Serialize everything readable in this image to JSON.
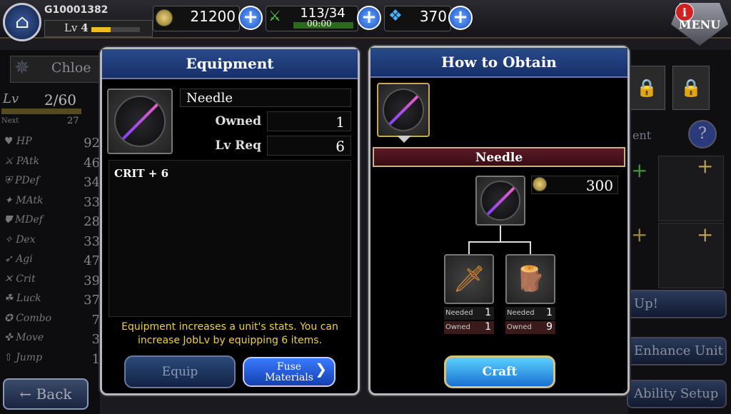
{
  "player": {
    "id": "G10001382",
    "level_label": "Lv",
    "level": "4"
  },
  "resources": {
    "gold": "21200",
    "stamina": "113/34",
    "stamina_timer": "00:00",
    "gems": "370"
  },
  "menu_label": "MENU",
  "notif_label": "i",
  "background": {
    "unit_name": "Chloe",
    "lv_label": "Lv",
    "lv_value": "2/60",
    "next_label": "Next",
    "next_value": "27",
    "stats": [
      {
        "name": "HP",
        "value": "92"
      },
      {
        "name": "PAtk",
        "value": "46"
      },
      {
        "name": "PDef",
        "value": "34"
      },
      {
        "name": "MAtk",
        "value": "33"
      },
      {
        "name": "MDef",
        "value": "28"
      },
      {
        "name": "Dex",
        "value": "33"
      },
      {
        "name": "Agi",
        "value": "47"
      },
      {
        "name": "Crit",
        "value": "39"
      },
      {
        "name": "Luck",
        "value": "37"
      },
      {
        "name": "Combo",
        "value": "7"
      },
      {
        "name": "Move",
        "value": "3"
      },
      {
        "name": "Jump",
        "value": "1"
      }
    ],
    "back_label": "Back",
    "equipment_partial": "ent",
    "up_partial": "Up!",
    "enhance_label": "Enhance Unit",
    "ability_label": "Ability Setup"
  },
  "equipment": {
    "title": "Equipment",
    "item_name": "Needle",
    "owned_label": "Owned",
    "owned_value": "1",
    "lvreq_label": "Lv Req",
    "lvreq_value": "6",
    "effect": "CRIT + 6",
    "hint_line1": "Equipment increases a unit's stats. You can",
    "hint_line2": "increase JobLv by equipping 6 items.",
    "equip_label": "Equip",
    "fuse_label_1": "Fuse",
    "fuse_label_2": "Materials"
  },
  "obtain": {
    "title": "How to Obtain",
    "item_name": "Needle",
    "cost": "300",
    "materials": [
      {
        "icon": "sword-icon",
        "needed_label": "Needed",
        "needed": "1",
        "owned_label": "Owned",
        "owned": "1"
      },
      {
        "icon": "branch-icon",
        "needed_label": "Needed",
        "needed": "1",
        "owned_label": "Owned",
        "owned": "9"
      }
    ],
    "craft_label": "Craft"
  }
}
